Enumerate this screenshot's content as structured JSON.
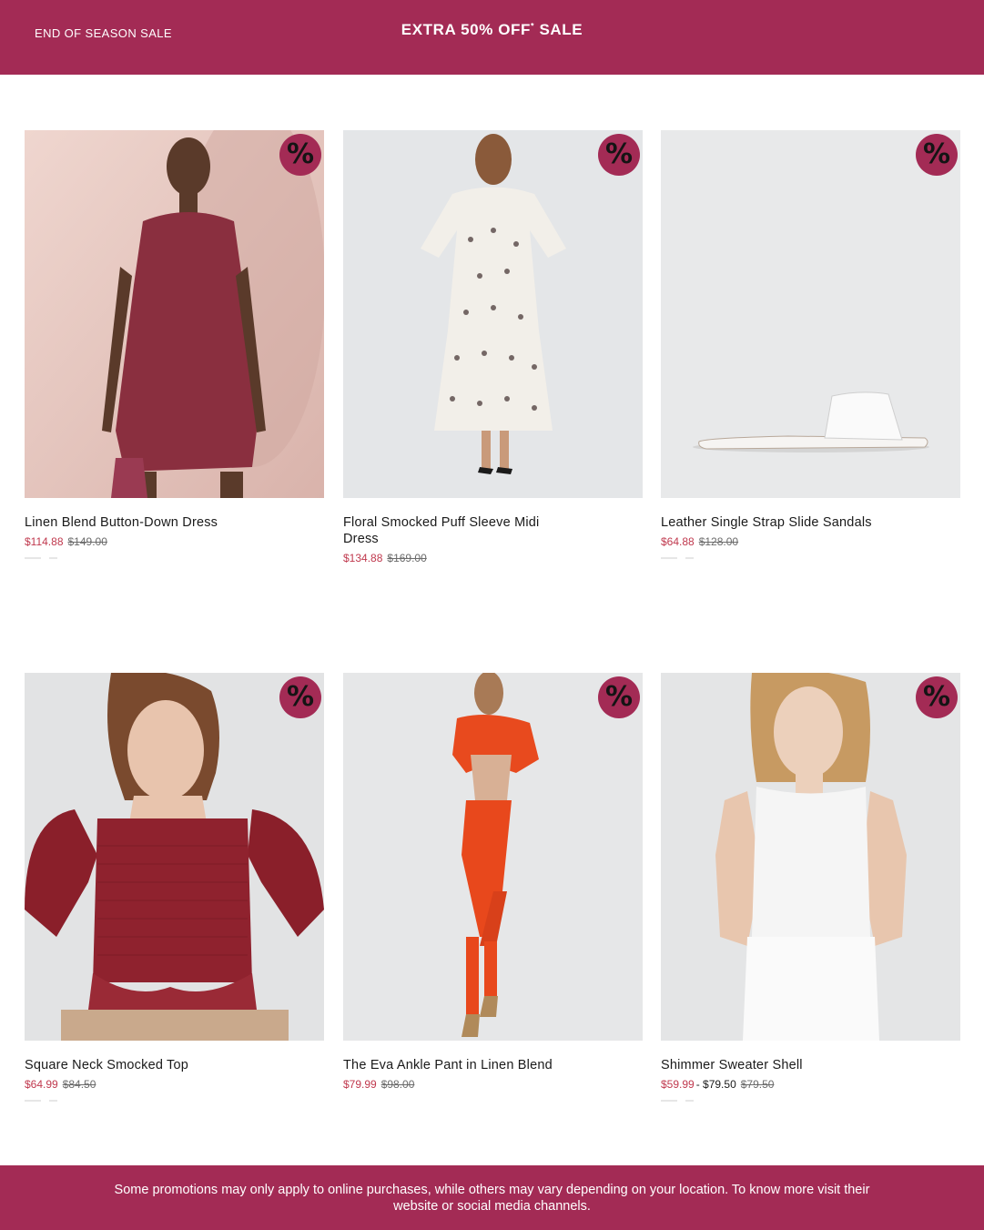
{
  "banner": {
    "left_label": "END OF SEASON SALE",
    "headline": "EXTRA 50% OFF",
    "headline_mark": "*",
    "headline_suffix": " SALE",
    "color": "#a32b55"
  },
  "badge_icon": "percent-icon",
  "badge_glyph": "%",
  "products": [
    {
      "name": "Linen Blend Button-Down Dress",
      "sale": "$114.88",
      "range": "",
      "original": "$149.00"
    },
    {
      "name": "Floral Smocked Puff Sleeve Midi Dress",
      "sale": "$134.88",
      "range": "",
      "original": "$169.00"
    },
    {
      "name": "Leather Single Strap Slide Sandals",
      "sale": "$64.88",
      "range": "",
      "original": "$128.00"
    },
    {
      "name": "Square Neck Smocked Top",
      "sale": "$64.99",
      "range": "",
      "original": "$84.50"
    },
    {
      "name": "The Eva Ankle Pant in Linen Blend",
      "sale": "$79.99",
      "range": "",
      "original": "$98.00"
    },
    {
      "name": "Shimmer Sweater Shell",
      "sale": "$59.99",
      "range": "- $79.50",
      "original": "$79.50"
    }
  ],
  "footer": {
    "disclaimer": "Some promotions may only apply to online purchases, while others may vary depending on your location. To know more visit their website or social media channels."
  }
}
